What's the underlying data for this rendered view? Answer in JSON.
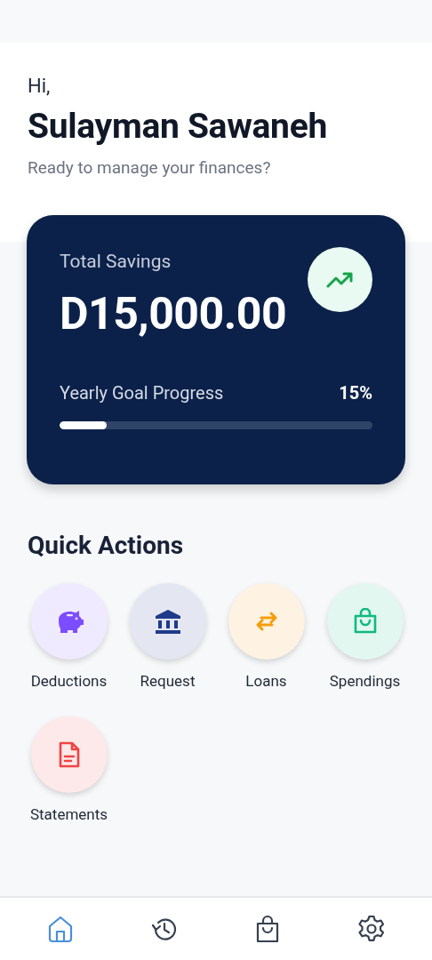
{
  "greeting": {
    "hello": "Hi,",
    "name": "Sulayman Sawaneh",
    "subtitle": "Ready to manage your finances?"
  },
  "savings_card": {
    "label": "Total Savings",
    "amount": "D15,000.00",
    "goal_label": "Yearly Goal Progress",
    "goal_percent": "15%",
    "level": 0.15
  },
  "quick_actions": {
    "title": "Quick Actions",
    "items": [
      {
        "label": "Deductions",
        "kind": "piggy",
        "color": "#7c4dff"
      },
      {
        "label": "Request",
        "kind": "bank",
        "color": "#1e3a8a"
      },
      {
        "label": "Loans",
        "kind": "swap",
        "color": "#f59e0b"
      },
      {
        "label": "Spendings",
        "kind": "bag",
        "color": "#10b981"
      },
      {
        "label": "Statements",
        "kind": "document",
        "color": "#ef4444"
      }
    ]
  },
  "bottom_nav": [
    {
      "kind": "home",
      "selected": true
    },
    {
      "kind": "history",
      "selected": false
    },
    {
      "kind": "bag",
      "selected": false
    },
    {
      "kind": "settings",
      "selected": false
    }
  ]
}
